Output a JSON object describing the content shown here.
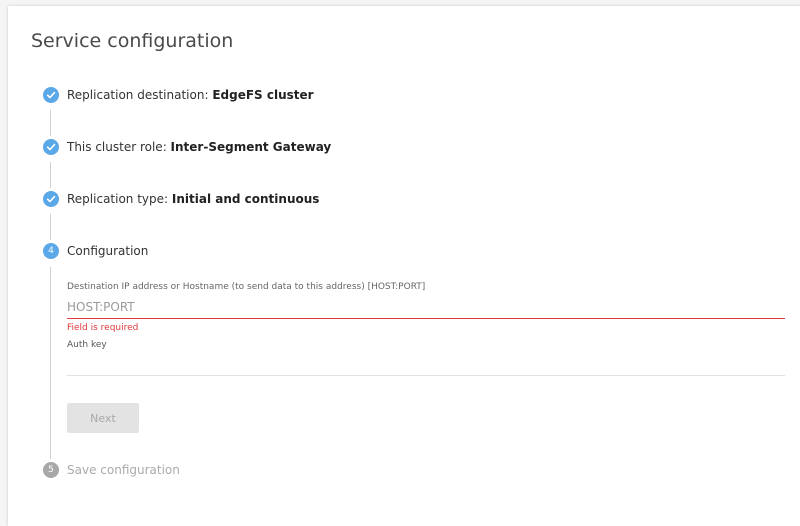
{
  "page": {
    "title": "Service configuration"
  },
  "steps": [
    {
      "number": "1",
      "label": "Replication destination: ",
      "value": "EdgeFS cluster",
      "state": "done"
    },
    {
      "number": "2",
      "label": "This cluster role: ",
      "value": "Inter-Segment Gateway",
      "state": "done"
    },
    {
      "number": "3",
      "label": "Replication type: ",
      "value": "Initial and continuous",
      "state": "done"
    },
    {
      "number": "4",
      "label": "Configuration",
      "value": "",
      "state": "active"
    },
    {
      "number": "5",
      "label": "Save configuration",
      "value": "",
      "state": "pending"
    }
  ],
  "form": {
    "destination_label": "Destination IP address or Hostname (to send data to this address) [HOST:PORT]",
    "destination_placeholder": "HOST:PORT",
    "destination_value": "",
    "destination_error": "Field is required",
    "auth_label": "Auth key",
    "auth_value": "",
    "next_label": "Next"
  },
  "colors": {
    "accent": "#5aa8e8",
    "error": "#e0393e",
    "pending": "#a8a8a8"
  },
  "icons": {
    "done": "check-icon"
  }
}
